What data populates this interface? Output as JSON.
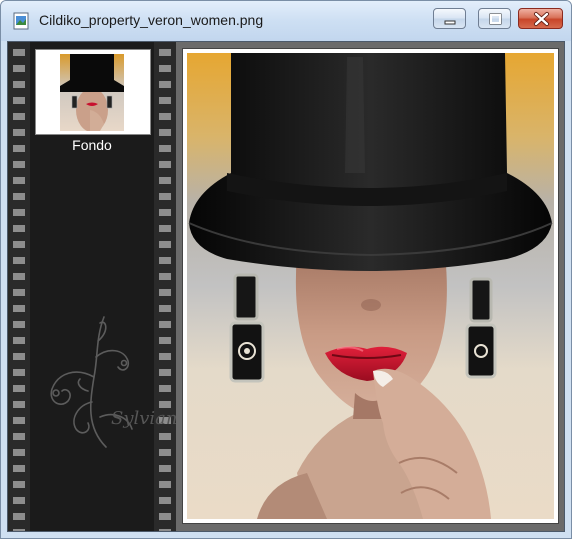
{
  "window": {
    "title": "Cildiko_property_veron_women.png",
    "controls": [
      "minimize",
      "maximize",
      "close"
    ]
  },
  "layers_panel": {
    "items": [
      {
        "label": "Fondo",
        "icon": "portrait-thumbnail"
      }
    ],
    "watermark_signature": "Sylviane"
  },
  "preview": {
    "description_icon": "woman-in-top-hat-image"
  },
  "colors": {
    "titlebar": "#cfe0f2",
    "filmstrip": "#1b1b1b",
    "background_gold": "#e3a83a",
    "lips_red": "#c8102e"
  }
}
